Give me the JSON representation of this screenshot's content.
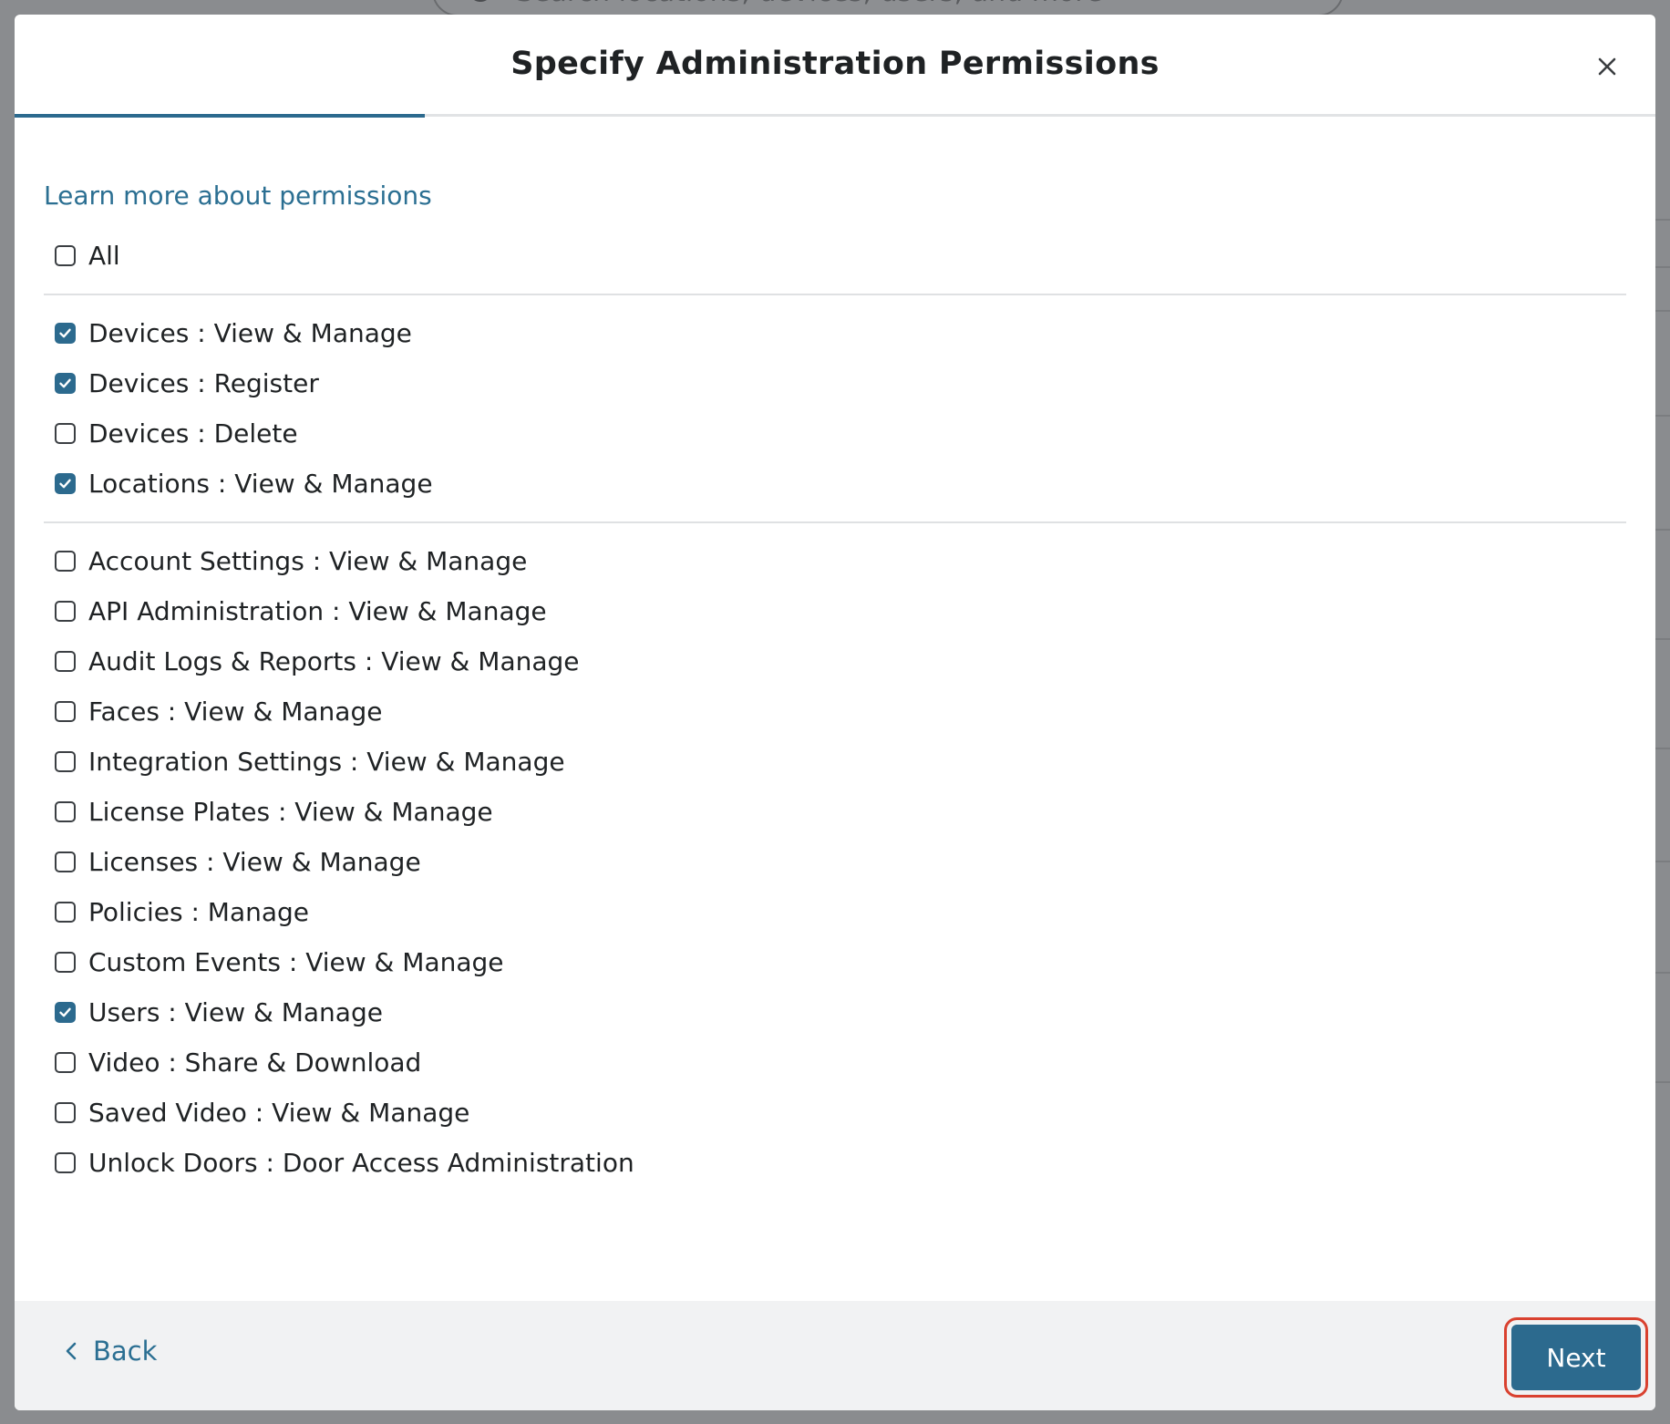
{
  "background": {
    "search_placeholder": "Search locations, devices, users, and more"
  },
  "modal": {
    "title": "Specify Administration Permissions",
    "close_icon": "close-icon",
    "progress_fraction": 0.25,
    "learn_more_label": "Learn more about permissions",
    "all_option": {
      "label": "All",
      "checked": false
    },
    "group_one": [
      {
        "label": "Devices : View & Manage",
        "checked": true
      },
      {
        "label": "Devices : Register",
        "checked": true
      },
      {
        "label": "Devices : Delete",
        "checked": false
      },
      {
        "label": "Locations : View & Manage",
        "checked": true
      }
    ],
    "group_two": [
      {
        "label": "Account Settings : View & Manage",
        "checked": false
      },
      {
        "label": "API Administration : View & Manage",
        "checked": false
      },
      {
        "label": "Audit Logs & Reports : View & Manage",
        "checked": false
      },
      {
        "label": "Faces : View & Manage",
        "checked": false
      },
      {
        "label": "Integration Settings : View & Manage",
        "checked": false
      },
      {
        "label": "License Plates : View & Manage",
        "checked": false
      },
      {
        "label": "Licenses : View & Manage",
        "checked": false
      },
      {
        "label": "Policies : Manage",
        "checked": false
      },
      {
        "label": "Custom Events : View & Manage",
        "checked": false
      },
      {
        "label": "Users : View & Manage",
        "checked": true
      },
      {
        "label": "Video : Share & Download",
        "checked": false
      },
      {
        "label": "Saved Video : View & Manage",
        "checked": false
      },
      {
        "label": "Unlock Doors : Door Access Administration",
        "checked": false
      }
    ],
    "footer": {
      "back_label": "Back",
      "back_icon": "chevron-left-icon",
      "next_label": "Next"
    }
  },
  "colors": {
    "accent": "#2c6a8e",
    "link": "#2b6f92",
    "highlight": "#d9412f",
    "footer_bg": "#f1f2f3"
  }
}
